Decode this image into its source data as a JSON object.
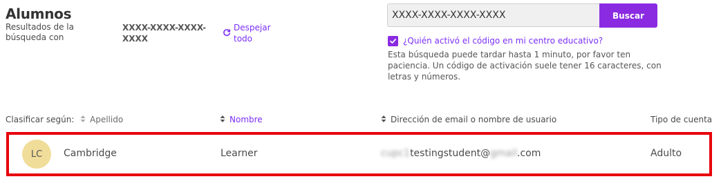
{
  "header": {
    "title": "Alumnos",
    "results_label": "Resultados de la búsqueda con",
    "search_code": "XXXX-XXXX-XXXX-XXXX",
    "clear_all_label": "Despejar todo"
  },
  "search": {
    "value": "XXXX-XXXX-XXXX-XXXX",
    "button_label": "Buscar",
    "who_activated_label": "¿Quién activó el código en mi centro educativo?",
    "who_activated_checked": true,
    "hint": "Esta búsqueda puede tardar hasta 1 minuto, por favor ten paciencia. Un código de activación suele tener 16 caracteres, con letras y números."
  },
  "sort": {
    "label": "Clasificar según:",
    "columns": [
      {
        "label": "Apellido",
        "active": false
      },
      {
        "label": "Nombre",
        "active": true
      },
      {
        "label": "Dirección de email o nombre de usuario",
        "active": false
      }
    ],
    "account_type_header": "Tipo de cuenta"
  },
  "results": [
    {
      "initials": "LC",
      "last_name": "Cambridge",
      "first_name": "Learner",
      "email_prefix_blurred": "cupc1",
      "email_middle": "testingstudent@",
      "email_domain_blurred": "gmail",
      "email_suffix": ".com",
      "account_type": "Adulto"
    }
  ],
  "colors": {
    "accent": "#8a2be2",
    "link": "#7b2ff7",
    "highlight": "#e8000b",
    "avatar_bg": "#f0dd9a"
  }
}
